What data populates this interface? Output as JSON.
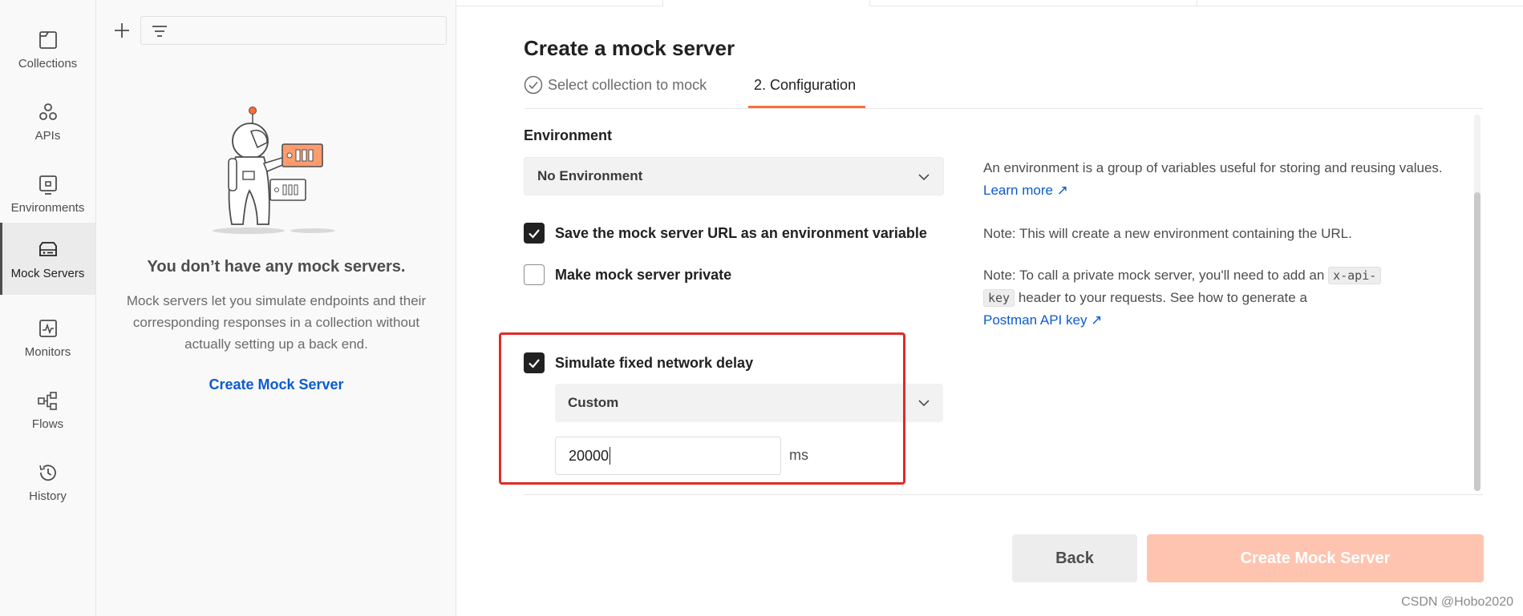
{
  "rail": {
    "items": [
      {
        "label": "Collections",
        "icon": "collections-icon"
      },
      {
        "label": "APIs",
        "icon": "apis-icon"
      },
      {
        "label": "Environments",
        "icon": "environments-icon"
      },
      {
        "label": "Mock Servers",
        "icon": "mock-servers-icon",
        "active": true
      },
      {
        "label": "Monitors",
        "icon": "monitors-icon"
      },
      {
        "label": "Flows",
        "icon": "flows-icon"
      },
      {
        "label": "History",
        "icon": "history-icon"
      }
    ]
  },
  "panel": {
    "empty_title": "You don’t have any mock servers.",
    "empty_desc": "Mock servers let you simulate endpoints and their corresponding responses in a collection without actually setting up a back end.",
    "create_link": "Create Mock Server"
  },
  "main": {
    "title": "Create a mock server",
    "steps": {
      "step1": "Select collection to mock",
      "step2": "2. Configuration"
    },
    "environment": {
      "label": "Environment",
      "selected": "No Environment"
    },
    "options": {
      "save_url": {
        "label": "Save the mock server URL as an environment variable",
        "checked": true
      },
      "private": {
        "label": "Make mock server private",
        "checked": false
      },
      "delay": {
        "label": "Simulate fixed network delay",
        "checked": true
      }
    },
    "delay_select": "Custom",
    "delay_value": "20000",
    "delay_unit": "ms",
    "help": {
      "env_text": "An environment is a group of variables useful for storing and reusing values.",
      "env_link": "Learn more ↗",
      "note1": "Note: This will create a new environment containing the URL.",
      "note2_pre": "Note: To call a private mock server, you'll need to add an",
      "note2_code1": "x-api-",
      "note2_code2": "key",
      "note2_post": "header to your requests. See how to generate a",
      "note2_link": "Postman API key ↗"
    },
    "buttons": {
      "back": "Back",
      "create": "Create Mock Server"
    }
  },
  "watermark": "CSDN @Hobo2020",
  "colors": {
    "accent": "#ff6c37",
    "link": "#0b5bd0",
    "highlight": "#e02b27",
    "create_disabled": "#ffc4b0"
  }
}
